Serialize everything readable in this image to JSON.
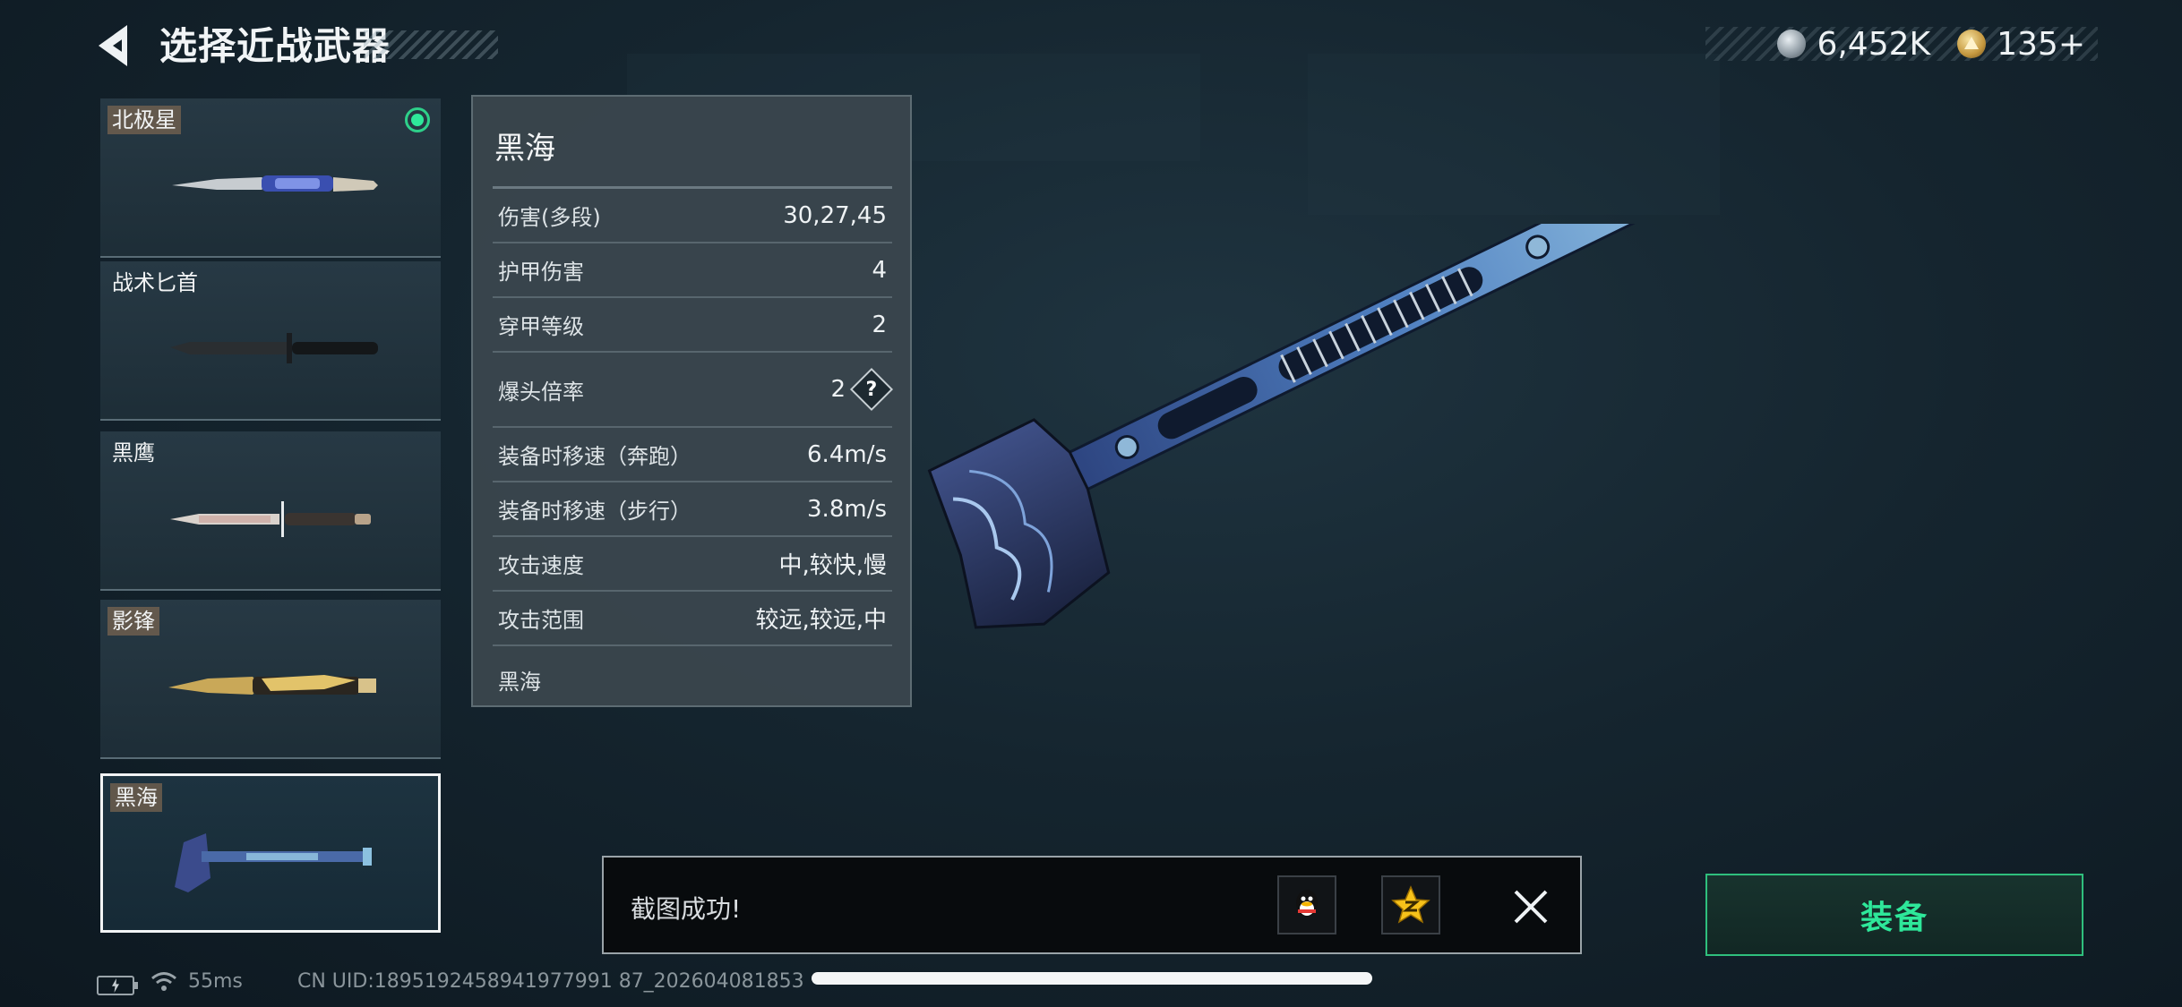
{
  "header": {
    "title": "选择近战武器",
    "currencies": [
      {
        "icon": "silver-coin-icon",
        "value": "6,452K"
      },
      {
        "icon": "gold-triangle-icon",
        "value": "135+"
      }
    ]
  },
  "weapons": [
    {
      "name": "北极星",
      "tagged": true,
      "equipped": true,
      "selected": false
    },
    {
      "name": "战术匕首",
      "tagged": false,
      "equipped": false,
      "selected": false
    },
    {
      "name": "黑鹰",
      "tagged": false,
      "equipped": false,
      "selected": false
    },
    {
      "name": "影锋",
      "tagged": true,
      "equipped": false,
      "selected": false
    },
    {
      "name": "黑海",
      "tagged": true,
      "equipped": false,
      "selected": true
    }
  ],
  "stats": {
    "title": "黑海",
    "rows": [
      {
        "label": "伤害(多段)",
        "value": "30,27,45"
      },
      {
        "label": "护甲伤害",
        "value": "4"
      },
      {
        "label": "穿甲等级",
        "value": "2"
      },
      {
        "label": "爆头倍率",
        "value": "2",
        "help": "?"
      },
      {
        "label": "装备时移速（奔跑）",
        "value": "6.4m/s"
      },
      {
        "label": "装备时移速（步行）",
        "value": "3.8m/s"
      },
      {
        "label": "攻击速度",
        "value": "中,较快,慢"
      },
      {
        "label": "攻击范围",
        "value": "较远,较远,中"
      }
    ],
    "footer": "黑海"
  },
  "toast": {
    "message": "截图成功!",
    "share_targets": [
      "qq-icon",
      "qzone-icon"
    ]
  },
  "equip_button": {
    "label": "装备"
  },
  "status_bar": {
    "ping": "55ms",
    "uid": "CN UID:1895192458941977991 87_202604081853"
  },
  "colors": {
    "accent_green": "#2ee89a",
    "background": "#15252f"
  }
}
